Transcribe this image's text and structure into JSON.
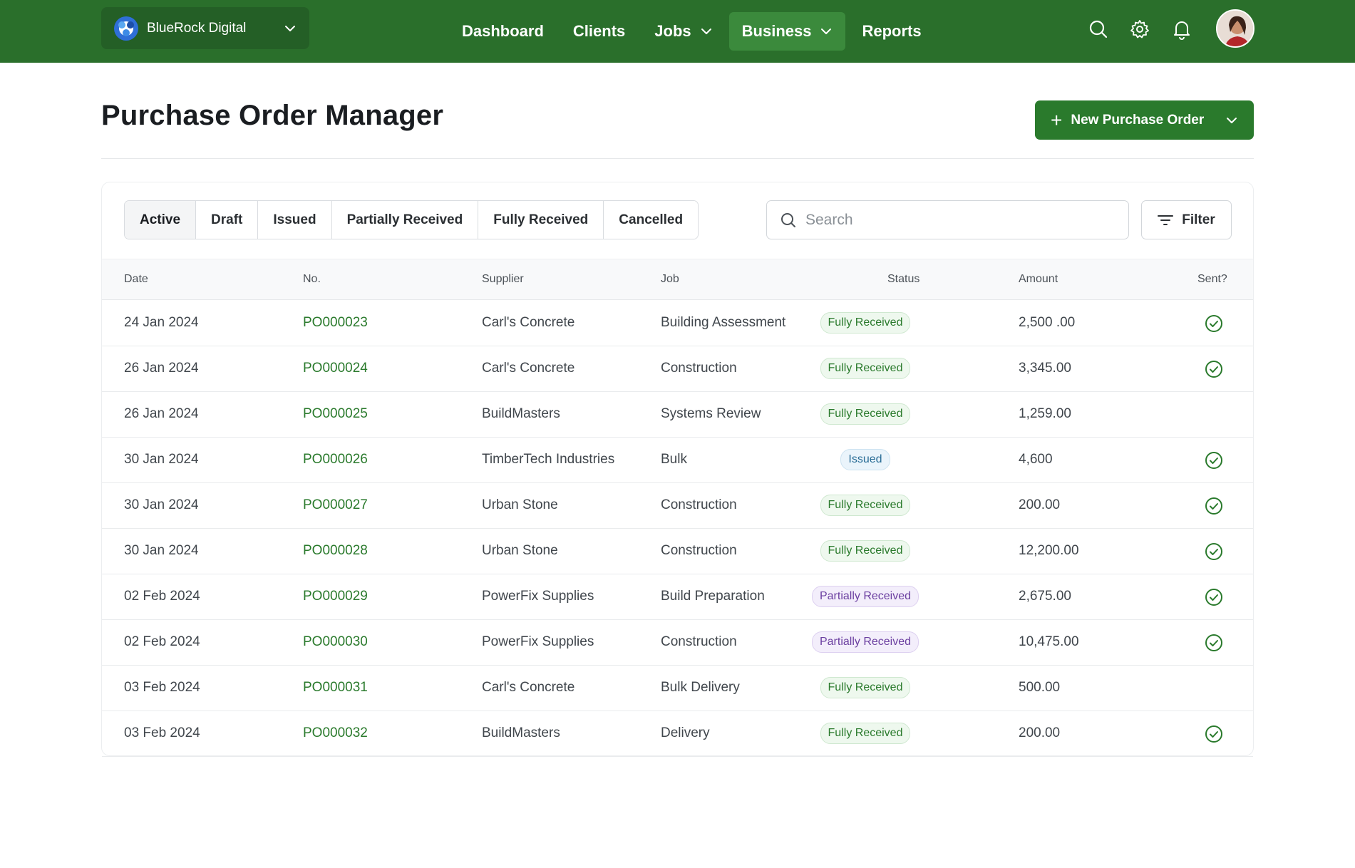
{
  "nav": {
    "brand": "BlueRock Digital",
    "items": [
      {
        "label": "Dashboard",
        "dropdown": false,
        "active": false
      },
      {
        "label": "Clients",
        "dropdown": false,
        "active": false
      },
      {
        "label": "Jobs",
        "dropdown": true,
        "active": false
      },
      {
        "label": "Business",
        "dropdown": true,
        "active": true
      },
      {
        "label": "Reports",
        "dropdown": false,
        "active": false
      }
    ],
    "icons": [
      "search-icon",
      "gear-icon",
      "bell-icon"
    ]
  },
  "page": {
    "title": "Purchase Order Manager",
    "new_button": "New Purchase Order"
  },
  "toolbar": {
    "tabs": [
      "Active",
      "Draft",
      "Issued",
      "Partially Received",
      "Fully Received",
      "Cancelled"
    ],
    "active_tab": "Active",
    "search_placeholder": "Search",
    "filter_label": "Filter"
  },
  "table": {
    "columns": [
      "Date",
      "No.",
      "Supplier",
      "Job",
      "Status",
      "Amount",
      "Sent?"
    ],
    "rows": [
      {
        "date": "24 Jan 2024",
        "no": "PO000023",
        "supplier": "Carl's Concrete",
        "job": "Building Assessment",
        "status": "Fully Received",
        "amount": "2,500 .00",
        "sent": true
      },
      {
        "date": "26 Jan 2024",
        "no": "PO000024",
        "supplier": "Carl's Concrete",
        "job": "Construction",
        "status": "Fully Received",
        "amount": "3,345.00",
        "sent": true
      },
      {
        "date": "26 Jan 2024",
        "no": "PO000025",
        "supplier": "BuildMasters",
        "job": "Systems Review",
        "status": "Fully Received",
        "amount": "1,259.00",
        "sent": false
      },
      {
        "date": "30 Jan 2024",
        "no": "PO000026",
        "supplier": "TimberTech Industries",
        "job": "Bulk",
        "status": "Issued",
        "amount": "4,600",
        "sent": true
      },
      {
        "date": "30 Jan 2024",
        "no": "PO000027",
        "supplier": "Urban Stone",
        "job": "Construction",
        "status": "Fully Received",
        "amount": "200.00",
        "sent": true
      },
      {
        "date": "30 Jan 2024",
        "no": "PO000028",
        "supplier": "Urban Stone",
        "job": "Construction",
        "status": "Fully Received",
        "amount": "12,200.00",
        "sent": true
      },
      {
        "date": "02 Feb 2024",
        "no": "PO000029",
        "supplier": "PowerFix Supplies",
        "job": "Build Preparation",
        "status": "Partially Received",
        "amount": "2,675.00",
        "sent": true
      },
      {
        "date": "02 Feb 2024",
        "no": "PO000030",
        "supplier": "PowerFix Supplies",
        "job": "Construction",
        "status": "Partially Received",
        "amount": "10,475.00",
        "sent": true
      },
      {
        "date": "03 Feb 2024",
        "no": "PO000031",
        "supplier": "Carl's Concrete",
        "job": "Bulk Delivery",
        "status": "Fully Received",
        "amount": "500.00",
        "sent": false
      },
      {
        "date": "03 Feb 2024",
        "no": "PO000032",
        "supplier": "BuildMasters",
        "job": "Delivery",
        "status": "Fully Received",
        "amount": "200.00",
        "sent": true
      }
    ]
  },
  "colors": {
    "nav_bg": "#2a6f2b",
    "accent": "#2a7a2c",
    "issued": "#2a6d96",
    "partial": "#6b3fa0"
  }
}
